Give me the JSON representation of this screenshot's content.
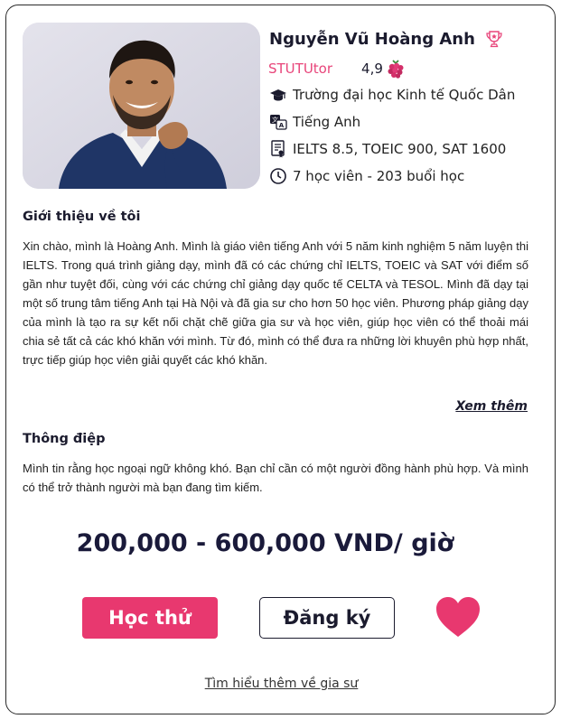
{
  "tutor": {
    "name": "Nguyễn Vũ Hoàng Anh",
    "badge_label": "STUTUtor",
    "rating": "4,9",
    "university": "Trường đại học Kinh tế Quốc Dân",
    "language": "Tiếng Anh",
    "certificates": "IELTS 8.5, TOEIC 900, SAT 1600",
    "stats": "7 học viên - 203 buổi học"
  },
  "about": {
    "title": "Giới thiệu về tôi",
    "text": "Xin chào, mình là Hoàng Anh. Mình là giáo viên tiếng Anh với 5 năm kinh nghiệm 5 năm luyện thi IELTS. Trong quá trình giảng dạy, mình đã có các chứng chỉ IELTS, TOEIC và SAT với điểm số gần như tuyệt đối, cùng với các chứng chỉ giảng dạy quốc tế CELTA và TESOL. Mình đã dạy tại một số trung tâm tiếng Anh tại Hà Nội và đã gia sư cho hơn 50 học viên. Phương pháp giảng dạy của mình là tạo ra sự kết nối chặt chẽ giữa gia sư và học viên, giúp học viên có thể thoải mái chia sẻ tất cả các khó khăn với mình. Từ đó, mình có thể đưa ra những lời khuyên phù hợp nhất, trực tiếp giúp học viên giải quyết các khó khăn.",
    "see_more": "Xem thêm"
  },
  "message": {
    "title": "Thông điệp",
    "text": "Mình tin rằng học ngoại ngữ không khó. Bạn chỉ cần có một người đồng hành phù hợp. Và mình có thể trở thành người mà bạn đang tìm kiếm."
  },
  "price": "200,000 - 600,000 VND/ giờ",
  "actions": {
    "trial": "Học thử",
    "register": "Đăng ký",
    "learn_more": "Tìm hiểu thêm về gia sư"
  },
  "colors": {
    "accent": "#e8386f",
    "dark": "#1b1b2e"
  },
  "icons": [
    "trophy-icon",
    "raspberry-icon",
    "graduation-cap-icon",
    "translate-icon",
    "certificate-icon",
    "clock-icon",
    "heart-icon"
  ]
}
